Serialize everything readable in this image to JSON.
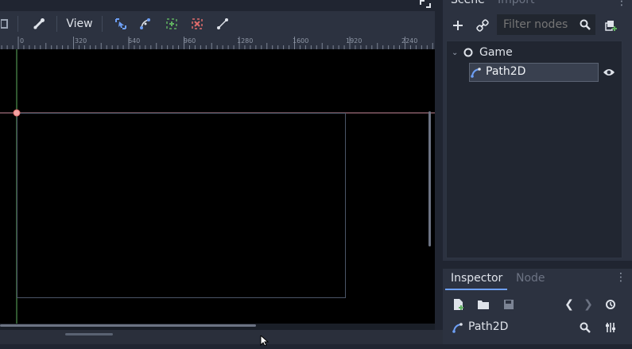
{
  "toolbar": {
    "view_label": "View",
    "icons": [
      "grid-snap-icon",
      "bone-icon",
      "select-points-icon",
      "add-point-icon",
      "curve-icon",
      "add-point-plus-icon",
      "delete-point-icon",
      "close-curve-icon"
    ]
  },
  "ruler": {
    "ticks": [
      "0",
      "320",
      "640",
      "960",
      "1280",
      "1600",
      "1920",
      "2240"
    ]
  },
  "scene_dock": {
    "tabs": [
      "Scene",
      "Import"
    ],
    "filter_placeholder": "Filter nodes",
    "tree": {
      "root": "Game",
      "child": "Path2D"
    }
  },
  "inspector_dock": {
    "tabs": [
      "Inspector",
      "Node"
    ],
    "object_name": "Path2D"
  },
  "colors": {
    "accent": "#6e9ff5",
    "selection_red": "#e06c6c",
    "y_axis_green": "#5fb060",
    "panel": "#2c3240",
    "background": "#202531"
  }
}
